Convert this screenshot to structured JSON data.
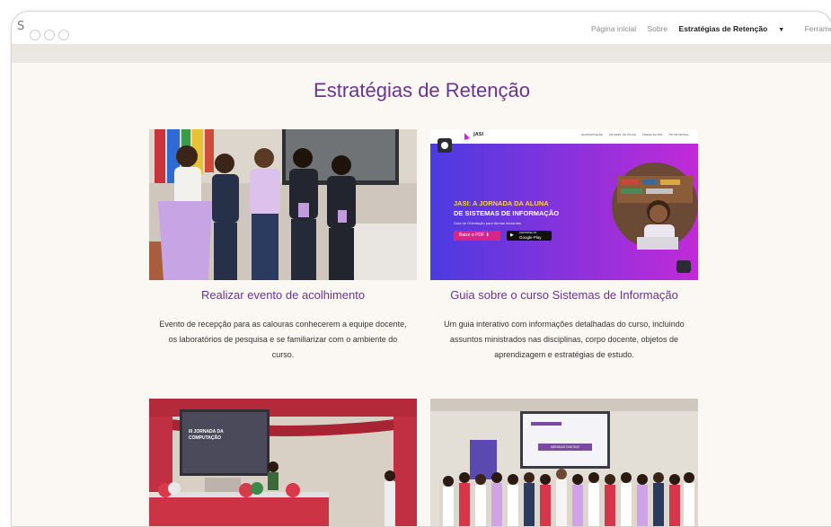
{
  "header": {
    "logo_fragment": "S",
    "nav": [
      {
        "label": "Página inicial"
      },
      {
        "label": "Sobre"
      },
      {
        "label": "Estratégias de Retenção",
        "active": true
      },
      {
        "label": "Ferramentas U"
      }
    ]
  },
  "page": {
    "title": "Estratégias de Retenção"
  },
  "cards": [
    {
      "title": "Realizar evento de acolhimento",
      "description_lines": [
        "Evento de recepção para as calouras conhecerem a equipe docente,",
        "os laboratórios de pesquisa e se familiarizar com o ambiente do",
        "curso."
      ]
    },
    {
      "title": "Guia sobre o curso Sistemas de Informação",
      "description_lines": [
        "Um guia interativo com informações detalhadas do curso, incluindo",
        "assuntos ministrados nas disciplinas, corpo docente, objetos de",
        "aprendizagem e estratégias de estudo."
      ],
      "preview": {
        "brand": "JASI",
        "nav": [
          "Apresentação",
          "Jornada da Aluna",
          "Nossa turma",
          "Ferramentas"
        ],
        "headline_accent": "JASI: A JORNADA DA ALUNA",
        "headline_rest": "DE SISTEMAS DE INFORMAÇÃO",
        "subtitle": "Guia de Orientação para Alunas Iniciantes",
        "pdf_button": "Baixe o PDF",
        "store_small": "DISPONÍVEL NO",
        "store_big": "Google Play"
      }
    },
    {
      "banner_text": "III JORNADA DA COMPUTAÇÃO"
    },
    {
      "screen_text": "MENINAS DIGITAIS"
    }
  ],
  "colors": {
    "accent": "#6b3391",
    "jasi_gradient_start": "#4b3be0",
    "jasi_gradient_end": "#c22ad8",
    "jasi_headline": "#ffd33d",
    "jasi_button": "#d8258b"
  }
}
